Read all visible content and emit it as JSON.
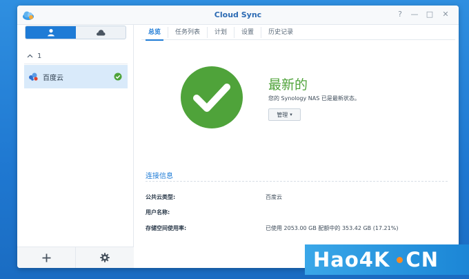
{
  "window": {
    "title": "Cloud Sync",
    "controls": {
      "help": "?",
      "minimize": "—",
      "maximize": "□",
      "close": "✕"
    }
  },
  "sidebar": {
    "tabs": [
      {
        "icon": "user-icon",
        "active": true
      },
      {
        "icon": "cloud-icon",
        "active": false
      }
    ],
    "group": {
      "toggle": "^",
      "label": "1"
    },
    "connections": [
      {
        "label": "百度云",
        "icon": "baidu-cloud-icon",
        "status": "check-circle-icon"
      }
    ],
    "footer": {
      "add_icon": "plus-icon",
      "settings_icon": "gear-icon"
    }
  },
  "main": {
    "tabs": [
      "总览",
      "任务列表",
      "计划",
      "设置",
      "历史记录"
    ],
    "status": {
      "title": "最新的",
      "description": "您的 Synology NAS 已是最新状态。",
      "manage_label": "管理",
      "manage_caret": "▾"
    },
    "connection_info": {
      "title": "连接信息",
      "rows": [
        {
          "label": "公共云类型:",
          "value": "百度云"
        },
        {
          "label": "用户名称:",
          "value": ""
        },
        {
          "label": "存储空间使用率:",
          "value": "已使用 2053.00 GB 配额中的 353.42 GB (17.21%)"
        }
      ]
    }
  },
  "watermark": {
    "text_left": "Hao4K",
    "text_right": "CN"
  },
  "colors": {
    "accent": "#1e7bd6",
    "success": "#4fa33a",
    "selected_bg": "#d9eafa",
    "desktop": "#1f78d1"
  }
}
